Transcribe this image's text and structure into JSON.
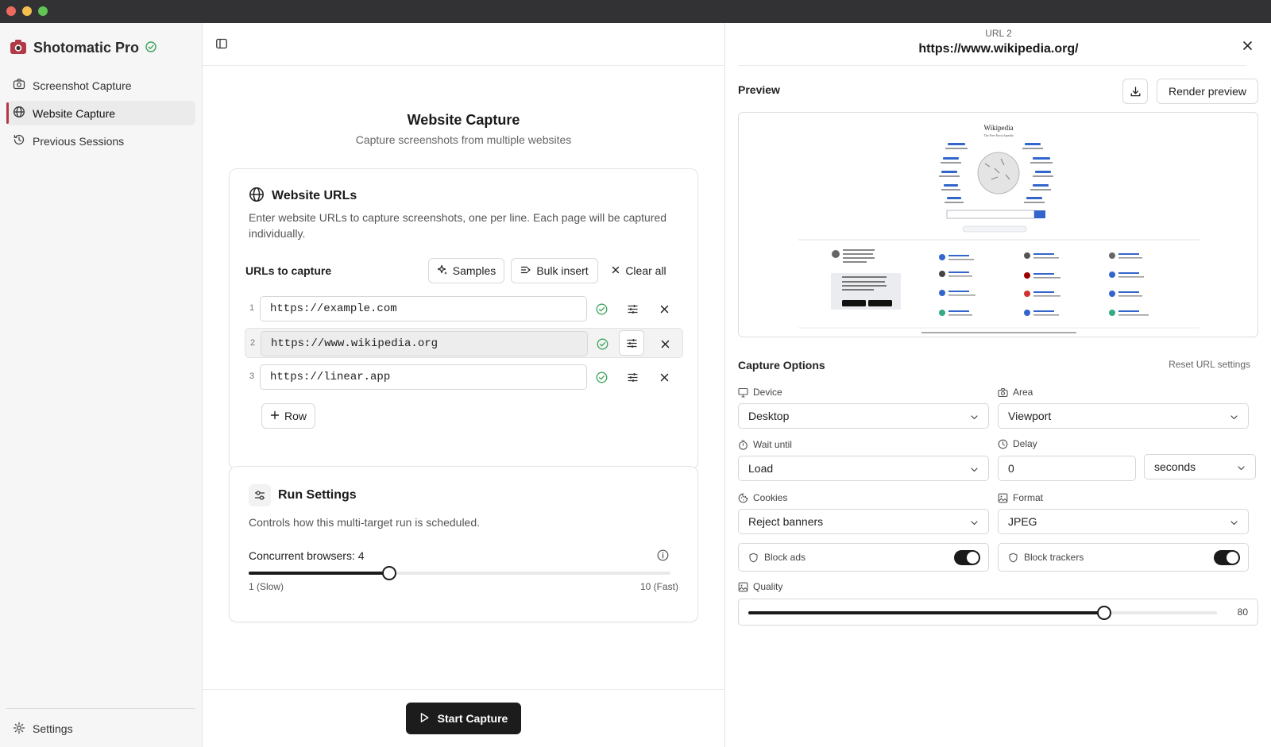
{
  "app": {
    "name": "Shotomatic Pro"
  },
  "sidebar": {
    "items": [
      {
        "label": "Screenshot Capture",
        "icon": "camera-icon"
      },
      {
        "label": "Website Capture",
        "icon": "globe-icon"
      },
      {
        "label": "Previous Sessions",
        "icon": "history-icon"
      }
    ],
    "settings_label": "Settings"
  },
  "main": {
    "title": "Website Capture",
    "subtitle": "Capture screenshots from multiple websites",
    "urls_card": {
      "title": "Website URLs",
      "description": "Enter website URLs to capture screenshots, one per line. Each page will be captured individually.",
      "list_label": "URLs to capture",
      "samples_label": "Samples",
      "bulk_label": "Bulk insert",
      "clear_label": "Clear all",
      "rows": [
        {
          "num": "1",
          "url": "https://example.com"
        },
        {
          "num": "2",
          "url": "https://www.wikipedia.org"
        },
        {
          "num": "3",
          "url": "https://linear.app"
        }
      ],
      "add_row_label": "Row"
    },
    "run_card": {
      "title": "Run Settings",
      "description": "Controls how this multi-target run is scheduled.",
      "concurrency_label": "Concurrent browsers: 4",
      "concurrency_value": 4,
      "concurrency_min": 1,
      "concurrency_max": 10,
      "min_label": "1 (Slow)",
      "max_label": "10 (Fast)"
    },
    "start_label": "Start Capture"
  },
  "panel": {
    "subtitle": "URL 2",
    "title": "https://www.wikipedia.org/",
    "preview_label": "Preview",
    "render_label": "Render preview",
    "preview": {
      "wordmark": "Wikipedia",
      "tagline": "The Free Encyclopedia"
    },
    "options_label": "Capture Options",
    "reset_label": "Reset URL settings",
    "device": {
      "label": "Device",
      "value": "Desktop"
    },
    "area": {
      "label": "Area",
      "value": "Viewport"
    },
    "wait": {
      "label": "Wait until",
      "value": "Load"
    },
    "delay": {
      "label": "Delay",
      "value": "0",
      "unit": "seconds"
    },
    "cookies": {
      "label": "Cookies",
      "value": "Reject banners"
    },
    "format": {
      "label": "Format",
      "value": "JPEG"
    },
    "block_ads": {
      "label": "Block ads",
      "on": true
    },
    "block_trackers": {
      "label": "Block trackers",
      "on": true
    },
    "quality": {
      "label": "Quality",
      "value": 80,
      "display": "80"
    }
  },
  "colors": {
    "accent": "#1c1c1c",
    "success": "#3aa35a",
    "active_marker": "#b23a48"
  }
}
